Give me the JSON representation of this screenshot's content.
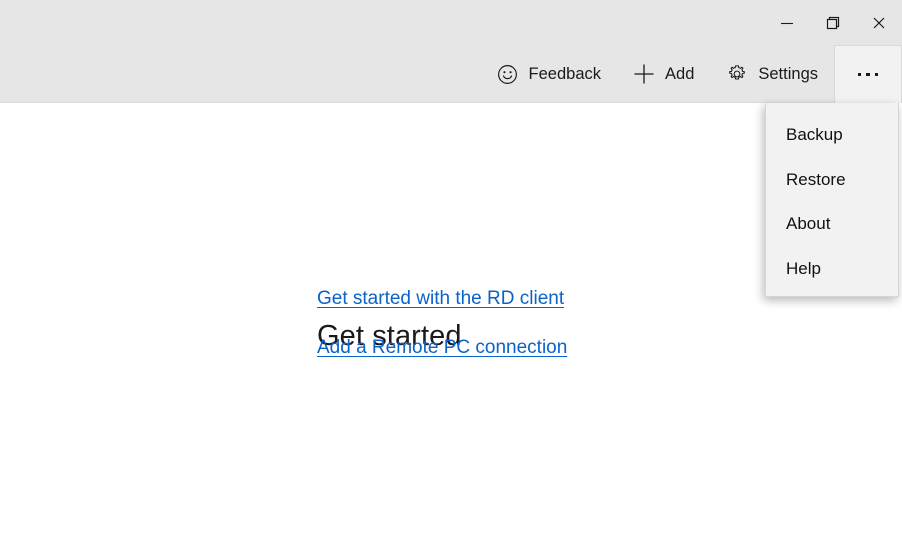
{
  "window": {
    "controls": [
      {
        "name": "minimize",
        "icon": "minimize-icon",
        "tooltip": "Minimize"
      },
      {
        "name": "restore",
        "icon": "restore-icon",
        "tooltip": "Restore Down"
      },
      {
        "name": "close",
        "icon": "close-icon",
        "tooltip": "Close"
      }
    ]
  },
  "commandbar": {
    "items": [
      {
        "label": "Feedback",
        "icon": "smiley-face-icon"
      },
      {
        "label": "Add",
        "icon": "plus-icon"
      },
      {
        "label": "Settings",
        "icon": "gear-icon"
      }
    ],
    "more": {
      "icon": "ellipsis-icon",
      "label": "See more"
    }
  },
  "content": {
    "heading": "Get started",
    "links": [
      "Get started with the RD client",
      "Add a Remote PC connection"
    ]
  },
  "menu": {
    "items": [
      "Backup",
      "Restore",
      "About",
      "Help"
    ],
    "highlighted_index": 0
  },
  "colors": {
    "chrome_background": "#e6e6e6",
    "content_background": "#ffffff",
    "menu_background": "#f2f2f2",
    "link": "#0a63c9",
    "text": "#1a1a1a",
    "highlight": "#f2ec00"
  }
}
